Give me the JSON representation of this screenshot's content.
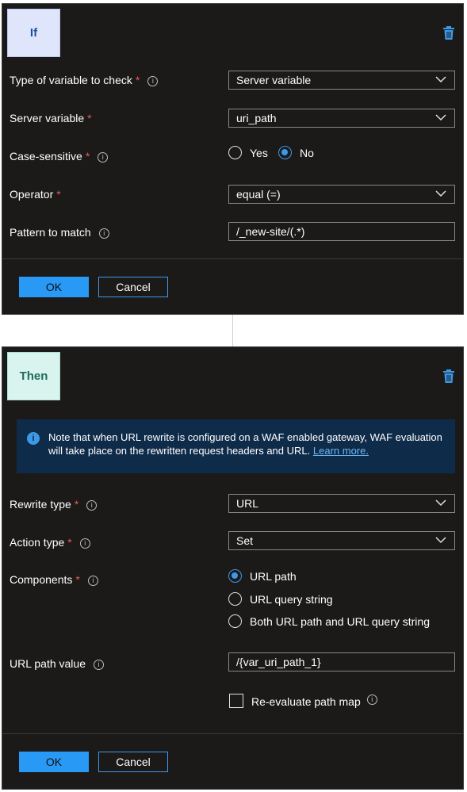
{
  "if_section": {
    "badge": "If",
    "fields": {
      "type_label": "Type of variable to check",
      "type_value": "Server variable",
      "server_var_label": "Server variable",
      "server_var_value": "uri_path",
      "case_label": "Case-sensitive",
      "case_yes": "Yes",
      "case_no": "No",
      "operator_label": "Operator",
      "operator_value": "equal (=)",
      "pattern_label": "Pattern to match",
      "pattern_value": "/_new-site/(.*)"
    },
    "ok": "OK",
    "cancel": "Cancel"
  },
  "then_section": {
    "badge": "Then",
    "note": {
      "text": "Note that when URL rewrite is configured on a WAF enabled gateway, WAF evaluation will take place on the rewritten request headers and URL.",
      "link": "Learn more."
    },
    "fields": {
      "rewrite_type_label": "Rewrite type",
      "rewrite_type_value": "URL",
      "action_type_label": "Action type",
      "action_type_value": "Set",
      "components_label": "Components",
      "components_options": [
        "URL path",
        "URL query string",
        "Both URL path and URL query string"
      ],
      "url_path_label": "URL path value",
      "url_path_value": "/{var_uri_path_1}",
      "reevaluate_label": "Re-evaluate path map"
    },
    "ok": "OK",
    "cancel": "Cancel"
  },
  "symbols": {
    "required": "*",
    "info": "i"
  },
  "colors": {
    "accent": "#2899f5",
    "panel": "#1b1a19",
    "required": "#e35b5b",
    "note_bg": "#0f2b4a"
  }
}
